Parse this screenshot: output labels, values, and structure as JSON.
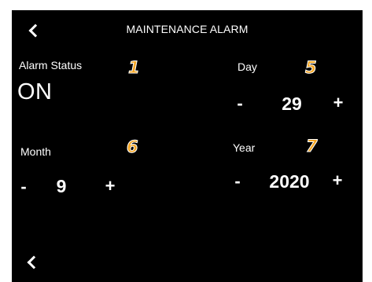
{
  "header": {
    "title": "MAINTENANCE ALARM"
  },
  "alarm_status": {
    "label": "Alarm Status",
    "value": "ON",
    "badge": "1"
  },
  "day": {
    "label": "Day",
    "value": "29",
    "minus": "-",
    "plus": "+",
    "badge": "5"
  },
  "month": {
    "label": "Month",
    "value": "9",
    "minus": "-",
    "plus": "+",
    "badge": "6"
  },
  "year": {
    "label": "Year",
    "value": "2020",
    "minus": "-",
    "plus": "+",
    "badge": "7"
  },
  "icons": {
    "top_back": "chevron-left-icon",
    "bottom_back": "chevron-left-icon"
  },
  "colors": {
    "screen_bg": "#000000",
    "text": "#ffffff",
    "badge": "#f5a623"
  }
}
